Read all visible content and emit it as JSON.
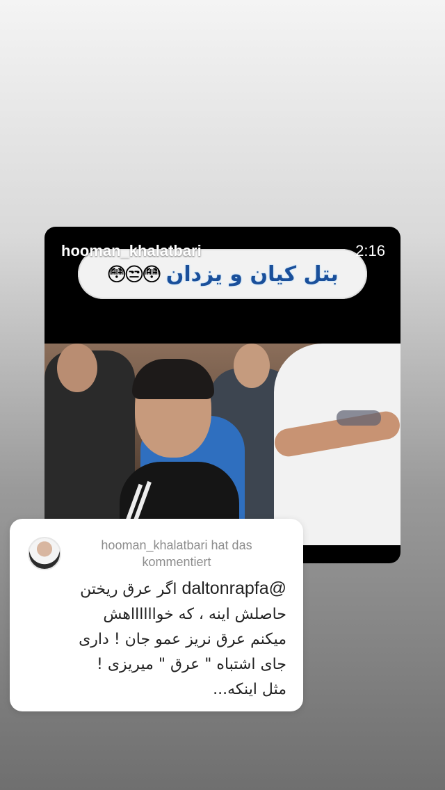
{
  "post": {
    "author": "hooman_khalatbari",
    "duration": "2:16",
    "video_title": "بتل کیان و یزدان",
    "video_title_emoji": "😳😒😳"
  },
  "comment": {
    "header": "hooman_khalatbari hat das kommentiert",
    "mention": "@daltonrapfa",
    "text": "اگر عرق ریختن   حاصلش اینه ، که خوااااااهش میکنم عرق نریز عمو جان ! داری جای اشتباه \" عرق \" میریزی ! مثل اینکه..."
  }
}
